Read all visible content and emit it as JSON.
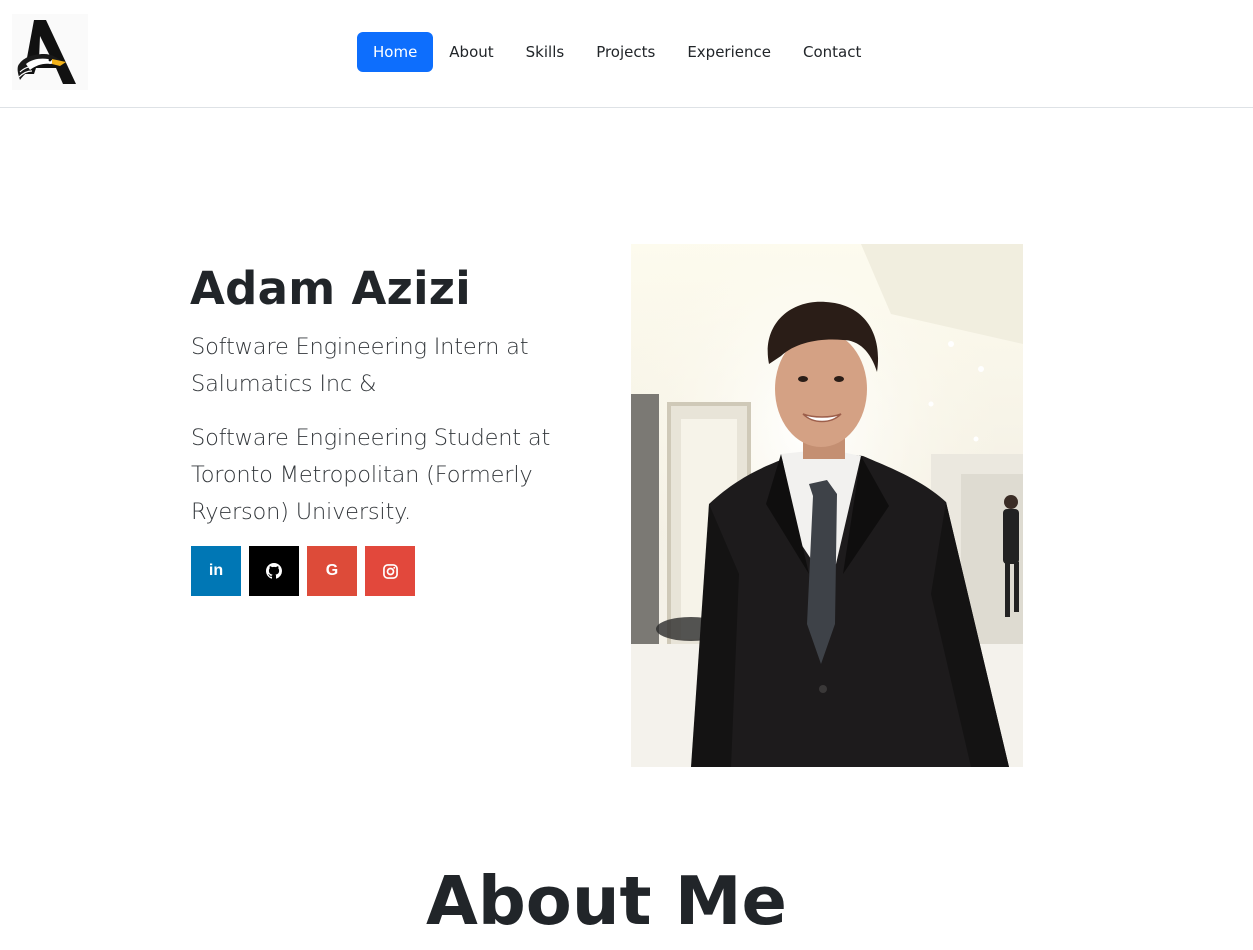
{
  "brand": {
    "logo_icon": "eagle-letter-a-logo",
    "logo_letter": "A"
  },
  "nav": {
    "items": [
      {
        "label": "Home",
        "active": true
      },
      {
        "label": "About",
        "active": false
      },
      {
        "label": "Skills",
        "active": false
      },
      {
        "label": "Projects",
        "active": false
      },
      {
        "label": "Experience",
        "active": false
      },
      {
        "label": "Contact",
        "active": false
      }
    ]
  },
  "hero": {
    "name": "Adam Azizi",
    "line1": "Software Engineering Intern at Salumatics Inc &",
    "line2": "Software Engineering Student at Toronto Metropolitan (Formerly Ryerson) University.",
    "socials": [
      {
        "name": "linkedin",
        "label": "in",
        "color": "#0077b5"
      },
      {
        "name": "github",
        "icon": "github-icon",
        "color": "#000000"
      },
      {
        "name": "google",
        "label": "G",
        "color": "#dd4b39"
      },
      {
        "name": "instagram",
        "icon": "instagram-icon",
        "color": "#e2483c"
      }
    ],
    "photo_alt": "portrait-photo"
  },
  "about": {
    "title": "About Me"
  },
  "colors": {
    "primary": "#0d6efd",
    "text": "#212529",
    "border": "#dee2e6"
  }
}
